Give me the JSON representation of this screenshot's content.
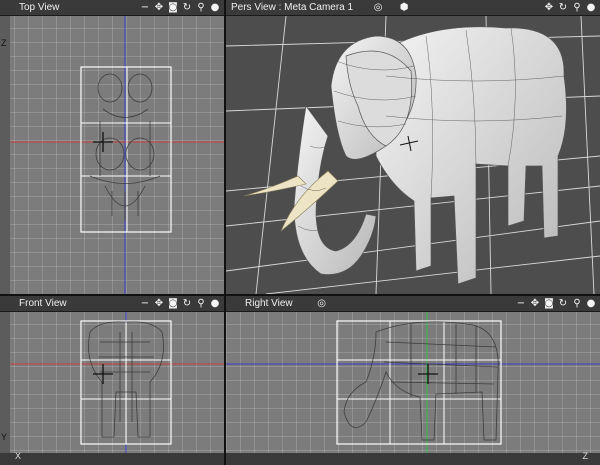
{
  "views": {
    "top": {
      "title": "Top View"
    },
    "pers": {
      "title": "Pers View : Meta Camera 1"
    },
    "front": {
      "title": "Front View"
    },
    "right": {
      "title": "Right View"
    }
  },
  "icons": {
    "minus": "−",
    "move": "✥",
    "camera": "◙",
    "rotate": "↻",
    "zoom": "⚲",
    "sphere": "●",
    "target": "◎",
    "cube": "⬢"
  },
  "axes": {
    "z_top": "Z",
    "y_front": "Y",
    "x_bottom": "X",
    "z_bottom": "Z"
  }
}
